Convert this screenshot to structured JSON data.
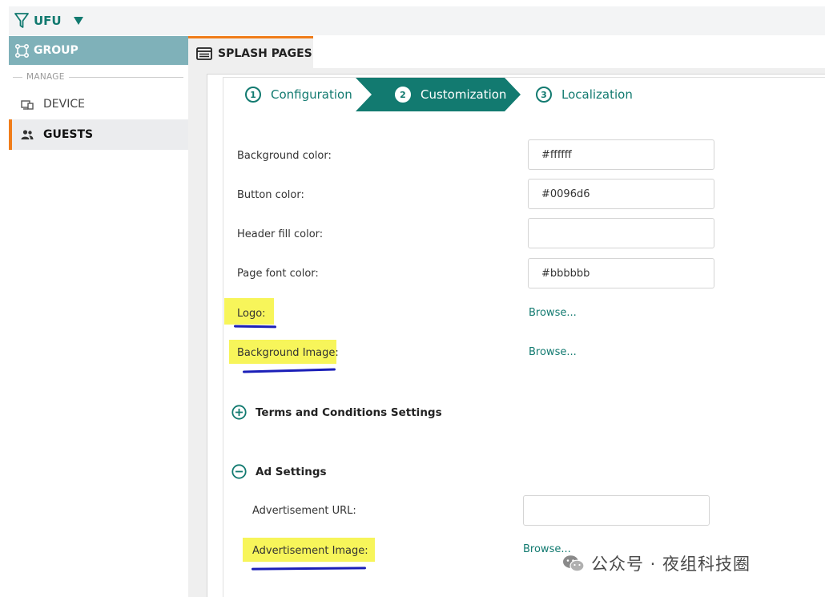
{
  "topbar": {
    "site_name": "UFU"
  },
  "sidebar": {
    "group_label": "GROUP",
    "section_label": "MANAGE",
    "items": [
      {
        "label": "DEVICE"
      },
      {
        "label": "GUESTS"
      }
    ]
  },
  "tab": {
    "label": "SPLASH PAGES"
  },
  "steps": [
    {
      "num": "1",
      "label": "Configuration"
    },
    {
      "num": "2",
      "label": "Customization"
    },
    {
      "num": "3",
      "label": "Localization"
    }
  ],
  "form": {
    "background_color": {
      "label": "Background color:",
      "value": "#ffffff"
    },
    "button_color": {
      "label": "Button color:",
      "value": "#0096d6"
    },
    "header_fill_color": {
      "label": "Header fill color:",
      "value": ""
    },
    "page_font_color": {
      "label": "Page font color:",
      "value": "#bbbbbb"
    },
    "logo": {
      "label": "Logo:",
      "browse": "Browse..."
    },
    "background_image": {
      "label": "Background Image:",
      "browse": "Browse..."
    }
  },
  "terms_section": {
    "label": "Terms and Conditions Settings"
  },
  "ad_section": {
    "label": "Ad Settings",
    "ad_url": {
      "label": "Advertisement URL:",
      "value": ""
    },
    "ad_image": {
      "label": "Advertisement Image:",
      "browse": "Browse..."
    }
  },
  "watermark": {
    "text": "公众号 · 夜组科技圈"
  },
  "colors": {
    "accent": "#127a70",
    "group_header": "#7fb1b9",
    "active_tab_border": "#f07d1a",
    "highlight": "#f7f55a",
    "pen_underline": "#1b1fb8"
  }
}
